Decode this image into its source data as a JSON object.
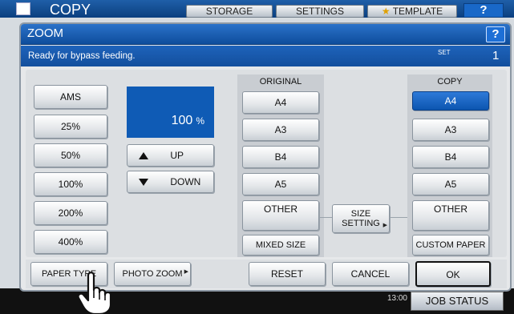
{
  "background": {
    "app_title": "COPY",
    "tabs": [
      "STORAGE",
      "SETTINGS",
      "TEMPLATE"
    ],
    "help": "?",
    "time": "13:00",
    "job_status": "JOB STATUS"
  },
  "dialog": {
    "title": "ZOOM",
    "help": "?",
    "status": "Ready for bypass feeding.",
    "set_label": "SET",
    "set_count": "1"
  },
  "zoom": {
    "presets": [
      "AMS",
      "25%",
      "50%",
      "100%",
      "200%",
      "400%"
    ],
    "value": "100",
    "unit": "%",
    "up": "UP",
    "down": "DOWN"
  },
  "original": {
    "header": "ORIGINAL",
    "sizes": [
      "A4",
      "A3",
      "B4",
      "A5",
      "OTHER"
    ],
    "mixed": "MIXED SIZE"
  },
  "size_setting": {
    "line1": "SIZE",
    "line2": "SETTING"
  },
  "copy": {
    "header": "COPY",
    "sizes": [
      "A4",
      "A3",
      "B4",
      "A5",
      "OTHER"
    ],
    "selected": "A4",
    "custom": "CUSTOM PAPER"
  },
  "footer": {
    "paper_type": "PAPER TYPE",
    "photo_zoom": "PHOTO ZOOM",
    "reset": "RESET",
    "cancel": "CANCEL",
    "ok": "OK"
  }
}
